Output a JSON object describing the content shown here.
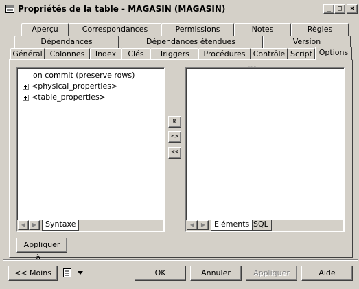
{
  "window": {
    "title": "Propriétés de la table - MAGASIN (MAGASIN)",
    "minimize_label": "_",
    "maximize_label": "□",
    "close_label": "×"
  },
  "tabs": {
    "row1": [
      "Aperçu",
      "Correspondances",
      "Permissions",
      "Notes",
      "Règles"
    ],
    "row2": [
      "Dépendances",
      "Dépendances étendues",
      "Version"
    ],
    "row3": [
      "Général",
      "Colonnes",
      "Index",
      "Clés",
      "Triggers",
      "Procédures",
      "Contrôle",
      "Script",
      "Options"
    ],
    "active": "Options"
  },
  "left_pane": {
    "items": [
      {
        "label": "on commit (preserve rows)",
        "expandable": false
      },
      {
        "label": "<physical_properties>",
        "expandable": true
      },
      {
        "label": "<table_properties>",
        "expandable": true
      }
    ],
    "bottom_tab": "Syntaxe"
  },
  "middle_buttons": {
    "add_label": "⊠",
    "edit_label": "<>",
    "remove_label": "<<"
  },
  "right_pane": {
    "top_marker": "\"\"\"",
    "bottom_tabs": [
      "Eléments",
      "SQL"
    ],
    "active_tab": "Eléments"
  },
  "buttons": {
    "apply_to": "Appliquer à...",
    "less": "<< Moins",
    "ok": "OK",
    "cancel": "Annuler",
    "apply": "Appliquer",
    "help": "Aide"
  },
  "icons": {
    "menu_icon": "list-icon",
    "dropdown_icon": "triangle-down-icon"
  }
}
